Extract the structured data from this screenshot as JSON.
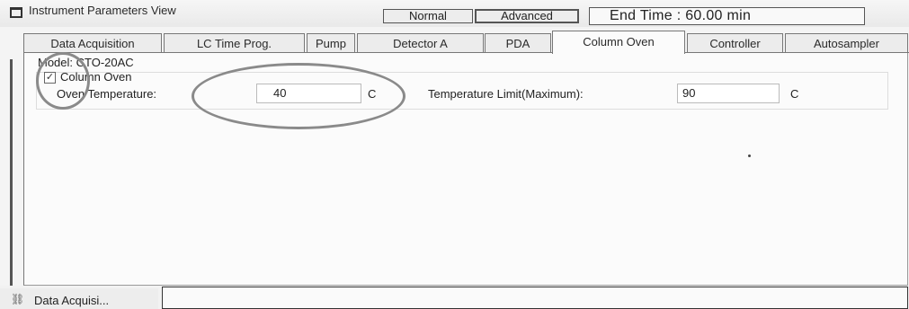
{
  "window": {
    "title": "Instrument Parameters View",
    "icon": "window-icon"
  },
  "mode": {
    "normal_label": "Normal",
    "advanced_label": "Advanced",
    "end_time": "End Time : 60.00 min"
  },
  "tabs": [
    {
      "label": "Data Acquisition",
      "active": false
    },
    {
      "label": "LC Time Prog.",
      "active": false
    },
    {
      "label": "Pump",
      "active": false
    },
    {
      "label": "Detector A",
      "active": false
    },
    {
      "label": "PDA",
      "active": false
    },
    {
      "label": "Column Oven",
      "active": true
    },
    {
      "label": "Controller",
      "active": false
    },
    {
      "label": "Autosampler",
      "active": false
    }
  ],
  "column_oven": {
    "model_text": "Model: CTO-20AC",
    "checkbox_label": "Column Oven",
    "checkbox_checked": true,
    "checkbox_mark": "✓",
    "oven_temperature_label": "Oven Temperature:",
    "oven_temperature_value": "40",
    "oven_temperature_unit": "C",
    "temperature_limit_label": "Temperature Limit(Maximum):",
    "temperature_limit_value": "90",
    "temperature_limit_unit": "C"
  },
  "bottom_bar": {
    "tab_label": "Data Acquisi...",
    "tab_icon": "data-acquisition-icon"
  },
  "colors": {
    "panel_background": "#fbfbfb",
    "annotation_circle": "#8a8a8a",
    "tab_border": "#777777"
  }
}
